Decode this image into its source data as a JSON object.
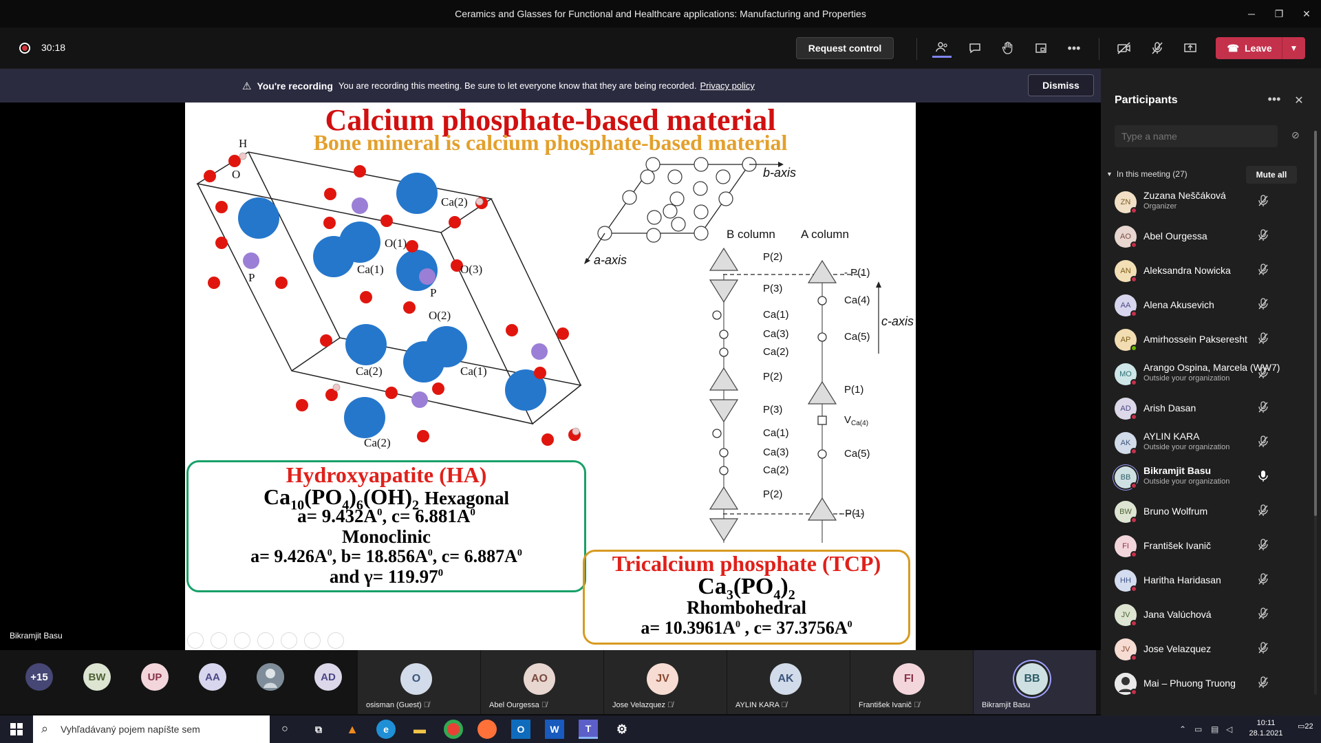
{
  "window": {
    "title": "Ceramics and Glasses for Functional and Healthcare applications: Manufacturing and Properties"
  },
  "meeting": {
    "timer": "30:18",
    "request_control": "Request control",
    "leave": "Leave"
  },
  "banner": {
    "title": "You're recording",
    "text": "You are recording this meeting. Be sure to let everyone know that they are being recorded.",
    "link": "Privacy policy",
    "dismiss": "Dismiss"
  },
  "slide": {
    "title": "Calcium phosphate-based material",
    "subtitle": "Bone mineral is calcium phosphate-based material",
    "crystal_labels": {
      "h": "H",
      "o": "O",
      "ca2a": "Ca(2)",
      "o1": "O(1)",
      "ca1a": "Ca(1)",
      "o3": "O(3)",
      "p1": "P",
      "p2": "P",
      "o2": "O(2)",
      "ca2b": "Ca(2)",
      "ca1b": "Ca(1)",
      "ca2c": "Ca(2)"
    },
    "diagram": {
      "b_axis": "b-axis",
      "a_axis": "a-axis",
      "c_axis": "c-axis",
      "b_column": "B column",
      "a_column": "A column",
      "left_labels": [
        "P(2)",
        "P(3)",
        "Ca(1)",
        "Ca(3)",
        "Ca(2)",
        "P(2)",
        "P(3)",
        "Ca(1)",
        "Ca(3)",
        "Ca(2)",
        "P(2)"
      ],
      "right_labels": [
        "P(1)",
        "Ca(4)",
        "Ca(5)",
        "P(1)",
        "V",
        "Ca(4)",
        "Ca(5)",
        "P(1)"
      ]
    },
    "ha": {
      "title": "Hydroxyapatite (HA)",
      "formula_main": "Ca",
      "formula_rest": "Hexagonal",
      "line2": "a= 9.432A",
      "line2b": ", c= 6.881A",
      "line3": "Monoclinic",
      "line4": "a= 9.426A",
      "line4b": ", b= 18.856A",
      "line4c": ", c= 6.887A",
      "line5": "and γ= 119.97"
    },
    "tcp": {
      "title": "Tricalcium phosphate (TCP)",
      "line3": "Rhombohedral",
      "line4": "a= 10.3961A",
      "line4b": " , c= 37.3756A"
    }
  },
  "presenter_label": "Bikramjit Basu",
  "participants": {
    "title": "Participants",
    "search_placeholder": "Type a name",
    "section": "In this meeting (27)",
    "mute_all": "Mute all",
    "list": [
      {
        "initials": "ZN",
        "name": "Zuzana Neščáková",
        "sub": "Organizer",
        "color": "#f1e0c5",
        "fg": "#7a5b22"
      },
      {
        "initials": "AO",
        "name": "Abel Ourgessa",
        "sub": "",
        "color": "#e8d6d0",
        "fg": "#7a4b3f"
      },
      {
        "initials": "AN",
        "name": "Aleksandra Nowicka",
        "sub": "",
        "color": "#f3dfb5",
        "fg": "#7a5b18"
      },
      {
        "initials": "AA",
        "name": "Alena Akusevich",
        "sub": "",
        "color": "#d8d6ee",
        "fg": "#4b4784"
      },
      {
        "initials": "AP",
        "name": "Amirhossein Pakseresht",
        "sub": "",
        "color": "#f2ddb2",
        "fg": "#7a5a17"
      },
      {
        "initials": "MO",
        "name": "Arango Ospina, Marcela (WW7)",
        "sub": "Outside your organization",
        "color": "#cfe6e8",
        "fg": "#2b6e73"
      },
      {
        "initials": "AD",
        "name": "Arish Dasan",
        "sub": "",
        "color": "#dcd8ea",
        "fg": "#4b4784"
      },
      {
        "initials": "AK",
        "name": "AYLIN KARA",
        "sub": "Outside your organization",
        "color": "#d2dbe9",
        "fg": "#3c557c"
      },
      {
        "initials": "BB",
        "name": "Bikramjit Basu",
        "sub": "Outside your organization",
        "color": "#cfe0e3",
        "fg": "#2d5c66"
      },
      {
        "initials": "BW",
        "name": "Bruno Wolfrum",
        "sub": "",
        "color": "#dde5d2",
        "fg": "#4f6235"
      },
      {
        "initials": "FI",
        "name": "František Ivanič",
        "sub": "",
        "color": "#f3d6dc",
        "fg": "#8a3549"
      },
      {
        "initials": "HH",
        "name": "Haritha Haridasan",
        "sub": "",
        "color": "#d4dcef",
        "fg": "#3f5485"
      },
      {
        "initials": "JV",
        "name": "Jana Valúchová",
        "sub": "",
        "color": "#dde5d2",
        "fg": "#4f6235"
      },
      {
        "initials": "JV",
        "name": "Jose Velazquez",
        "sub": "",
        "color": "#f6dcd2",
        "fg": "#8a4a33"
      },
      {
        "initials": "",
        "name": "Mai – Phuong Truong",
        "sub": "",
        "color": "#e9e9e9",
        "fg": "#333333"
      }
    ]
  },
  "gallery": {
    "more": "+15",
    "small": [
      {
        "initials": "BW",
        "color": "#dde5d2",
        "fg": "#4f6235"
      },
      {
        "initials": "UP",
        "color": "#f3d6dc",
        "fg": "#8a3549"
      },
      {
        "initials": "AA",
        "color": "#d8d6ee",
        "fg": "#4b4784"
      },
      {
        "initials": "",
        "color": "#8a9aa8",
        "fg": "#ffffff"
      },
      {
        "initials": "AD",
        "color": "#dcd8ea",
        "fg": "#4b4784"
      }
    ],
    "tiles": [
      {
        "initials": "O",
        "name": "osisman (Guest)",
        "color": "#d2dbe9",
        "fg": "#3c557c"
      },
      {
        "initials": "AO",
        "name": "Abel Ourgessa",
        "color": "#e8d6d0",
        "fg": "#7a4b3f"
      },
      {
        "initials": "JV",
        "name": "Jose Velazquez",
        "color": "#f6dcd2",
        "fg": "#8a4a33"
      },
      {
        "initials": "AK",
        "name": "AYLIN KARA",
        "color": "#d2dbe9",
        "fg": "#3c557c"
      },
      {
        "initials": "FI",
        "name": "František Ivanič",
        "color": "#f3d6dc",
        "fg": "#8a3549"
      },
      {
        "initials": "BB",
        "name": "Bikramjit Basu",
        "color": "#cfe0e3",
        "fg": "#2d5c66"
      }
    ]
  },
  "taskbar": {
    "search_placeholder": "Vyhľadávaný pojem napíšte sem",
    "time": "10:11",
    "date": "28.1.2021",
    "notifications": "22"
  }
}
